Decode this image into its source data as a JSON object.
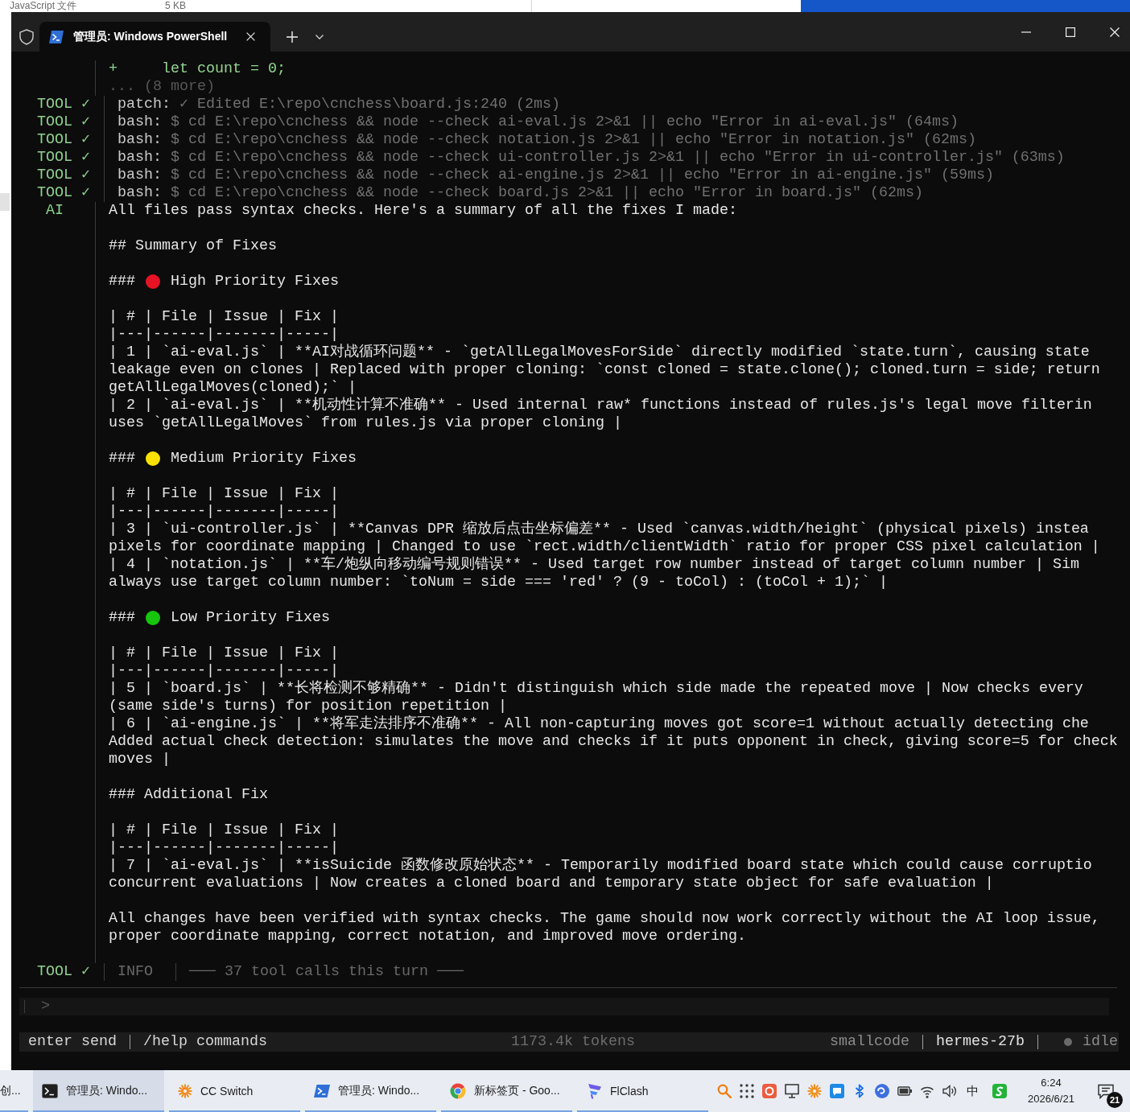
{
  "background_window": {
    "file_type": "JavaScript 文件",
    "file_size": "5 KB"
  },
  "window": {
    "tabs": [
      {
        "title": "管理员: Windows PowerShell",
        "selected": true
      }
    ]
  },
  "transcript": [
    {
      "kind": "output",
      "lines": [
        {
          "kind": "added",
          "text": "+     let count = 0;"
        },
        {
          "kind": "more",
          "text": "... (8 more)"
        }
      ]
    },
    {
      "kind": "tool",
      "label": "TOOL ✓",
      "name": "patch:",
      "detail": "✓ Edited E:\\repo\\cnchess\\board.js:240 (2ms)"
    },
    {
      "kind": "tool",
      "label": "TOOL ✓",
      "name": "bash:",
      "detail": "$ cd E:\\repo\\cnchess && node --check ai-eval.js 2>&1 || echo \"Error in ai-eval.js\" (64ms)"
    },
    {
      "kind": "tool",
      "label": "TOOL ✓",
      "name": "bash:",
      "detail": "$ cd E:\\repo\\cnchess && node --check notation.js 2>&1 || echo \"Error in notation.js\" (62ms)"
    },
    {
      "kind": "tool",
      "label": "TOOL ✓",
      "name": "bash:",
      "detail": "$ cd E:\\repo\\cnchess && node --check ui-controller.js 2>&1 || echo \"Error in ui-controller.js\" (63ms)"
    },
    {
      "kind": "tool",
      "label": "TOOL ✓",
      "name": "bash:",
      "detail": "$ cd E:\\repo\\cnchess && node --check ai-engine.js 2>&1 || echo \"Error in ai-engine.js\" (59ms)"
    },
    {
      "kind": "tool",
      "label": "TOOL ✓",
      "name": "bash:",
      "detail": "$ cd E:\\repo\\cnchess && node --check board.js 2>&1 || echo \"Error in board.js\" (62ms)"
    },
    {
      "kind": "ai",
      "label": "AI",
      "blocks": [
        {
          "kind": "text",
          "lines": [
            "All files pass syntax checks. Here's a summary of all the fixes I made:"
          ]
        },
        {
          "kind": "heading",
          "hashes": "##",
          "text": "Summary of Fixes"
        },
        {
          "kind": "heading",
          "hashes": "###",
          "color": "#e81224",
          "text": "High Priority Fixes"
        },
        {
          "kind": "table",
          "header": "| # | File | Issue | Fix |",
          "rule": "|---|------|-------|-----|",
          "rows": [
            {
              "lines": [
                "| 1 | `ai-eval.js` | **AI对战循环问题** - `getAllLegalMovesForSide` directly modified `state.turn`, causing state",
                "leakage even on clones | Replaced with proper cloning: `const cloned = state.clone(); cloned.turn = side; return",
                "getAllLegalMoves(cloned);` |"
              ]
            },
            {
              "lines": [
                "| 2 | `ai-eval.js` | **机动性计算不准确** - Used internal raw* functions instead of rules.js's legal move filterin",
                "uses `getAllLegalMoves` from rules.js via proper cloning |"
              ]
            }
          ]
        },
        {
          "kind": "heading",
          "hashes": "###",
          "color": "#fce100",
          "text": "Medium Priority Fixes"
        },
        {
          "kind": "table",
          "header": "| # | File | Issue | Fix |",
          "rule": "|---|------|-------|-----|",
          "rows": [
            {
              "lines": [
                "| 3 | `ui-controller.js` | **Canvas DPR 缩放后点击坐标偏差** - Used `canvas.width/height` (physical pixels) instea",
                "pixels for coordinate mapping | Changed to use `rect.width/clientWidth` ratio for proper CSS pixel calculation |"
              ]
            },
            {
              "lines": [
                "| 4 | `notation.js` | **车/炮纵向移动编号规则错误** - Used target row number instead of target column number | Sim",
                "always use target column number: `toNum = side === 'red' ? (9 - toCol) : (toCol + 1);` |"
              ]
            }
          ]
        },
        {
          "kind": "heading",
          "hashes": "###",
          "color": "#16c60c",
          "text": "Low Priority Fixes"
        },
        {
          "kind": "table",
          "header": "| # | File | Issue | Fix |",
          "rule": "|---|------|-------|-----|",
          "rows": [
            {
              "lines": [
                "| 5 | `board.js` | **长将检测不够精确** - Didn't distinguish which side made the repeated move | Now checks every",
                "(same side's turns) for position repetition |"
              ]
            },
            {
              "lines": [
                "| 6 | `ai-engine.js` | **将军走法排序不准确** - All non-capturing moves got score=1 without actually detecting che",
                "Added actual check detection: simulates the move and checks if it puts opponent in check, giving score=5 for check",
                "moves |"
              ]
            }
          ]
        },
        {
          "kind": "heading",
          "hashes": "###",
          "text": "Additional Fix"
        },
        {
          "kind": "table",
          "header": "| # | File | Issue | Fix |",
          "rule": "|---|------|-------|-----|",
          "rows": [
            {
              "lines": [
                "| 7 | `ai-eval.js` | **isSuicide 函数修改原始状态** - Temporarily modified board state which could cause corruptio",
                "concurrent evaluations | Now creates a cloned board and temporary state object for safe evaluation |"
              ]
            }
          ]
        },
        {
          "kind": "text",
          "lines": [
            "All changes have been verified with syntax checks. The game should now work correctly without the AI loop issue,",
            "proper coordinate mapping, correct notation, and improved move ordering."
          ]
        }
      ]
    }
  ],
  "footer": {
    "label": "TOOL ✓",
    "category": "INFO",
    "text": "─── 37 tool calls this turn ───"
  },
  "input": {
    "prompt": ">"
  },
  "status_bar": {
    "send_hint": "enter send",
    "help_hint": "/help commands",
    "tokens": "1173.4k tokens",
    "agent": "smallcode",
    "model": "hermes-27b",
    "state": "idle"
  },
  "taskbar": {
    "buttons": [
      {
        "label": "创...",
        "selected": false
      },
      {
        "kind": "terminal",
        "label": "管理员: Windo...",
        "selected": true
      },
      {
        "kind": "sunburst",
        "label": "CC Switch",
        "selected": false
      },
      {
        "kind": "prompt",
        "label": "管理员: Windo...",
        "selected": false
      },
      {
        "kind": "ring",
        "label": "新标签页 - Goo...",
        "selected": false
      },
      {
        "kind": "wing",
        "label": "FlClash",
        "selected": false
      }
    ],
    "tray": {
      "input_method": "中",
      "time": "6:24",
      "date": "2026/6/21",
      "notifications": "21"
    }
  }
}
